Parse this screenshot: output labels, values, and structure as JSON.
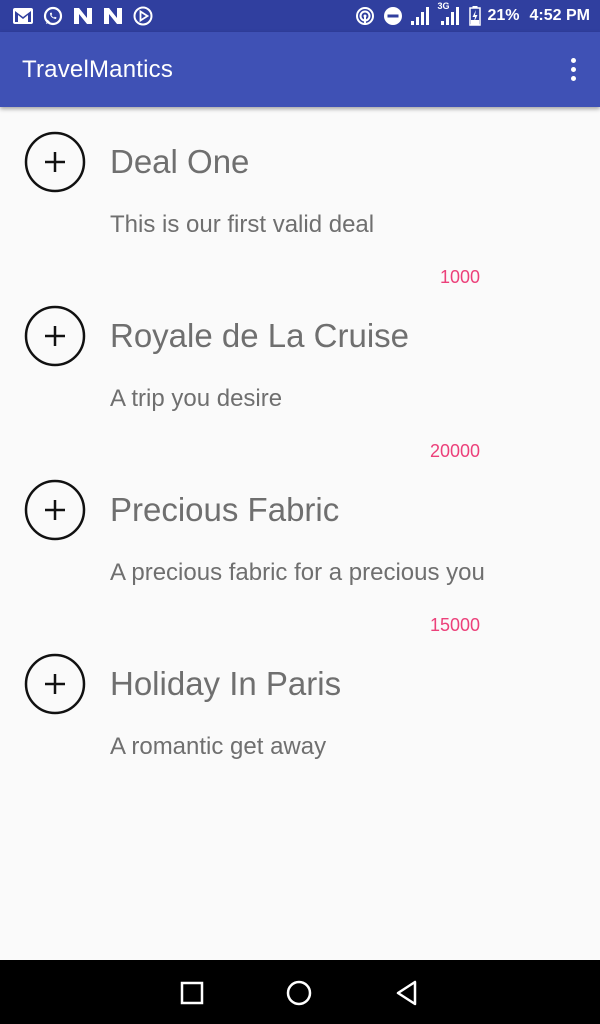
{
  "status_bar": {
    "battery": "21%",
    "time": "4:52 PM",
    "network": "3G",
    "icons": [
      "gmail-icon",
      "whatsapp-icon",
      "n-app-icon",
      "n-app-icon",
      "play-icon",
      "hotspot-icon",
      "dnd-icon",
      "signal-icon",
      "battery-icon"
    ]
  },
  "app_bar": {
    "title": "TravelMantics",
    "overflow_icon": "more-vert-icon"
  },
  "deals": [
    {
      "title": "Deal One",
      "description": "This is our first valid deal",
      "price": "1000"
    },
    {
      "title": "Royale de La Cruise",
      "description": "A trip you desire",
      "price": "20000"
    },
    {
      "title": "Precious Fabric",
      "description": "A precious fabric for a precious you",
      "price": "15000"
    },
    {
      "title": "Holiday In Paris",
      "description": "A romantic get away",
      "price": ""
    }
  ],
  "colors": {
    "status_bar": "#303f9f",
    "app_bar": "#3f51b5",
    "price": "#ec407a",
    "text": "#6f6f6f"
  },
  "nav_bar": {
    "buttons": [
      "recents-icon",
      "home-icon",
      "back-icon"
    ]
  }
}
